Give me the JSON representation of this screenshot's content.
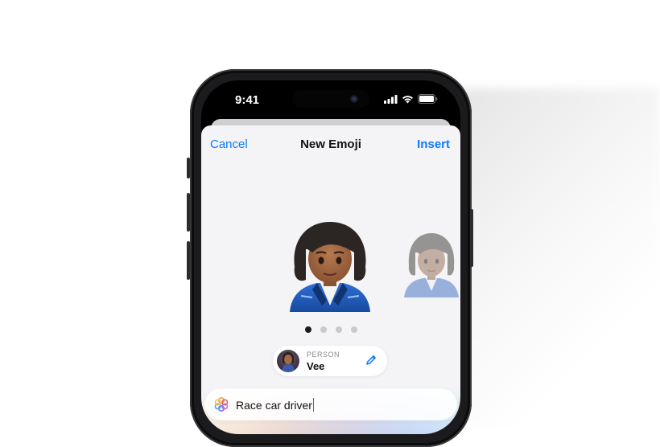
{
  "status_bar": {
    "time": "9:41"
  },
  "nav": {
    "cancel": "Cancel",
    "title": "New Emoji",
    "insert": "Insert"
  },
  "carousel": {
    "page_count": 4,
    "active_index": 0
  },
  "person": {
    "caption": "PERSON",
    "name": "Vee"
  },
  "prompt": {
    "value": "Race car driver"
  },
  "colors": {
    "accent": "#0a7aff",
    "sheet_background": "#f4f4f6",
    "phone_frame": "#1b1b1d"
  },
  "icons": {
    "signal": "cellular-signal-icon",
    "wifi": "wifi-icon",
    "battery": "battery-icon",
    "edit": "pencil-icon",
    "prompt": "image-playground-icon"
  }
}
